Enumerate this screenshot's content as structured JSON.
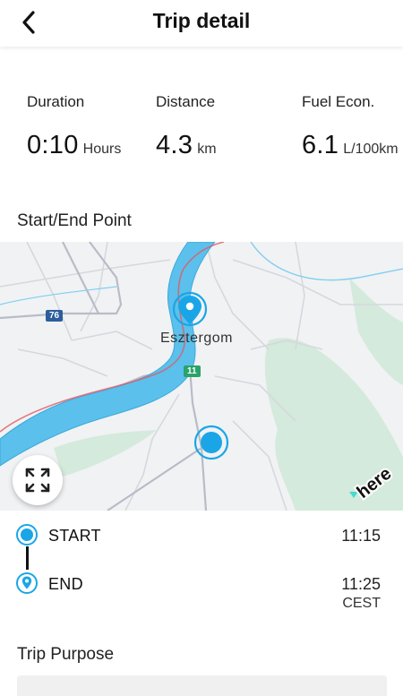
{
  "header": {
    "title": "Trip detail",
    "back_icon": "chevron-left-icon"
  },
  "stats": [
    {
      "label": "Duration",
      "value": "0:10",
      "unit": "Hours"
    },
    {
      "label": "Distance",
      "value": "4.3",
      "unit": "km"
    },
    {
      "label": "Fuel Econ.",
      "value": "6.1",
      "unit": "L/100km"
    }
  ],
  "sections": {
    "start_end": "Start/End Point",
    "purpose": "Trip Purpose"
  },
  "map": {
    "city_label": "Esztergom",
    "road_76": "76",
    "road_11": "11",
    "expand_icon": "expand-icon",
    "provider_logo": "here",
    "colors": {
      "river": "#5bc0eb",
      "water_edge": "#3ba9dc",
      "forest": "#cde6d6",
      "road": "#c9ccd3",
      "road_main": "#b8bcc6",
      "border": "#e05a66",
      "marker": "#1aa6e6"
    }
  },
  "timeline": {
    "start": {
      "label": "START",
      "time": "11:15"
    },
    "end": {
      "label": "END",
      "time": "11:25",
      "timezone": "CEST"
    }
  },
  "theme": {
    "accent": "#1aa6e6",
    "text": "#111111"
  }
}
